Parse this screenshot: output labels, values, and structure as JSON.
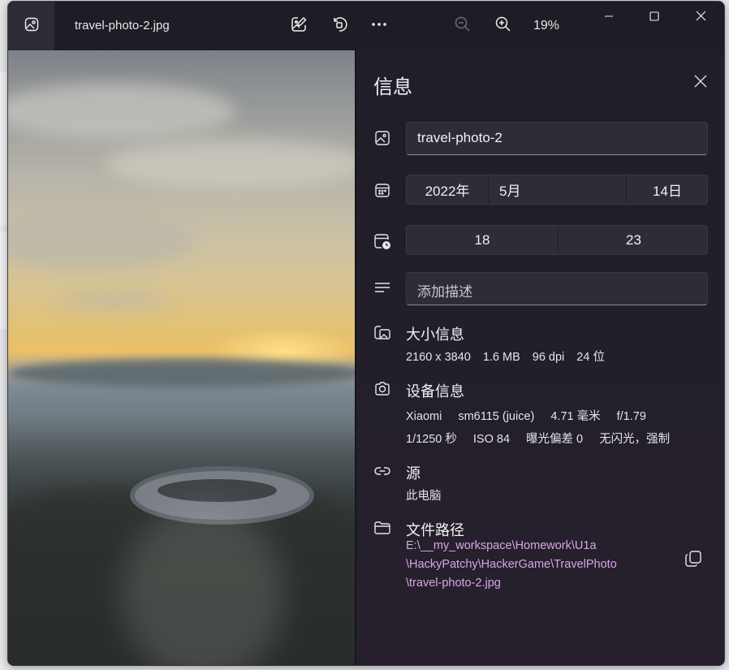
{
  "window": {
    "title": "travel-photo-2.jpg",
    "zoom_level": "19%"
  },
  "icons": {
    "app": "photos-icon",
    "edit": "edit-image-icon",
    "rotate": "rotate-icon",
    "more": "more-icon",
    "zoom_out": "zoom-out-icon",
    "zoom_in": "zoom-in-icon",
    "minimize": "minimize-icon",
    "maximize": "maximize-icon",
    "close": "close-icon",
    "copy": "copy-icon"
  },
  "info_panel": {
    "title": "信息",
    "file_name": "travel-photo-2",
    "date": {
      "year": "2022年",
      "month": "5月",
      "day": "14日"
    },
    "time": {
      "hour": "18",
      "minute": "23"
    },
    "description_placeholder": "添加描述",
    "size_section": {
      "title": "大小信息",
      "items": [
        "2160 x 3840",
        "1.6 MB",
        "96 dpi",
        "24 位"
      ]
    },
    "device_section": {
      "title": "设备信息",
      "line1": [
        "Xiaomi",
        "sm6115 (juice)",
        "4.71 毫米",
        "f/1.79"
      ],
      "line2": [
        "1/1250 秒",
        "ISO 84",
        "曝光偏差 0",
        "无闪光，强制"
      ]
    },
    "source_section": {
      "title": "源",
      "value": "此电脑"
    },
    "path_section": {
      "title": "文件路径",
      "lines": [
        "E:\\__my_workspace\\Homework\\U1a",
        "\\HackyPatchy\\HackerGame\\TravelPhoto",
        "\\travel-photo-2.jpg"
      ]
    }
  },
  "colors": {
    "panel_bg": "#221f2a",
    "field_bg": "#2e2c36",
    "path_link": "#d9a6e6"
  }
}
